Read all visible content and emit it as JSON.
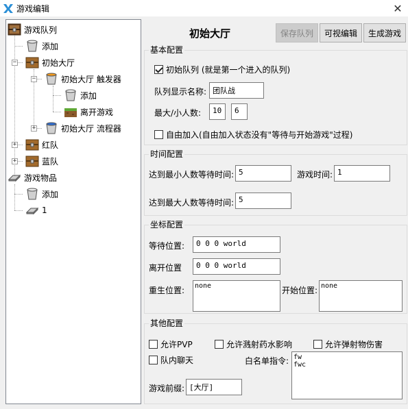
{
  "window": {
    "title": "游戏编辑",
    "close": "✕"
  },
  "tree": {
    "nodes": [
      {
        "label": "游戏队列",
        "icon": "chest-icon"
      },
      {
        "label": "添加",
        "icon": "bucket-icon"
      },
      {
        "label": "初始大厅",
        "icon": "chest-icon",
        "expanded": true
      },
      {
        "label": "初始大厅 触发器",
        "icon": "lava-bucket-icon",
        "expanded": true
      },
      {
        "label": "添加",
        "icon": "bucket-icon"
      },
      {
        "label": "离开游戏",
        "icon": "grass-block-icon"
      },
      {
        "label": "初始大厅 流程器",
        "icon": "water-bucket-icon",
        "expanded": false
      },
      {
        "label": "红队",
        "icon": "chest-icon",
        "expanded": false
      },
      {
        "label": "蓝队",
        "icon": "chest-icon",
        "expanded": false
      },
      {
        "label": "游戏物品",
        "icon": "iron-ingot-icon"
      },
      {
        "label": "添加",
        "icon": "bucket-icon"
      },
      {
        "label": "1",
        "icon": "iron-ingot-icon"
      }
    ]
  },
  "header": {
    "title": "初始大厅",
    "save_label": "保存队列",
    "visual_edit_label": "可视编辑",
    "generate_label": "生成游戏"
  },
  "basic": {
    "title": "基本配置",
    "initial_queue_label": "初始队列 (就是第一个进入的队列)",
    "initial_queue_checked": true,
    "display_name_label": "队列显示名称:",
    "display_name_value": "团队战",
    "maxmin_label": "最大/小人数:",
    "max_value": "10",
    "min_value": "6",
    "free_join_label": "自由加入(自由加入状态没有\"等待与开始游戏\"过程)",
    "free_join_checked": false
  },
  "time": {
    "title": "时间配置",
    "min_wait_label": "达到最小人数等待时间:",
    "min_wait_value": "5",
    "game_time_label": "游戏时间:",
    "game_time_value": "1",
    "max_wait_label": "达到最大人数等待时间:",
    "max_wait_value": "5"
  },
  "coords": {
    "title": "坐标配置",
    "wait_label": "等待位置:",
    "wait_value": "0 0 0 world",
    "leave_label": "离开位置",
    "leave_value": "0 0 0 world",
    "respawn_label": "重生位置:",
    "respawn_value": "none",
    "start_label": "开始位置:",
    "start_value": "none"
  },
  "other": {
    "title": "其他配置",
    "pvp_label": "允许PVP",
    "pvp_checked": false,
    "splash_label": "允许溅射药水影响",
    "splash_checked": false,
    "projectile_label": "允许弹射物伤害",
    "projectile_checked": false,
    "team_chat_label": "队内聊天",
    "team_chat_checked": false,
    "whitelist_label": "白名单指令:",
    "whitelist_value": "fw\nfwc",
    "prefix_label": "游戏前缀:",
    "prefix_value": "[大厅]"
  }
}
